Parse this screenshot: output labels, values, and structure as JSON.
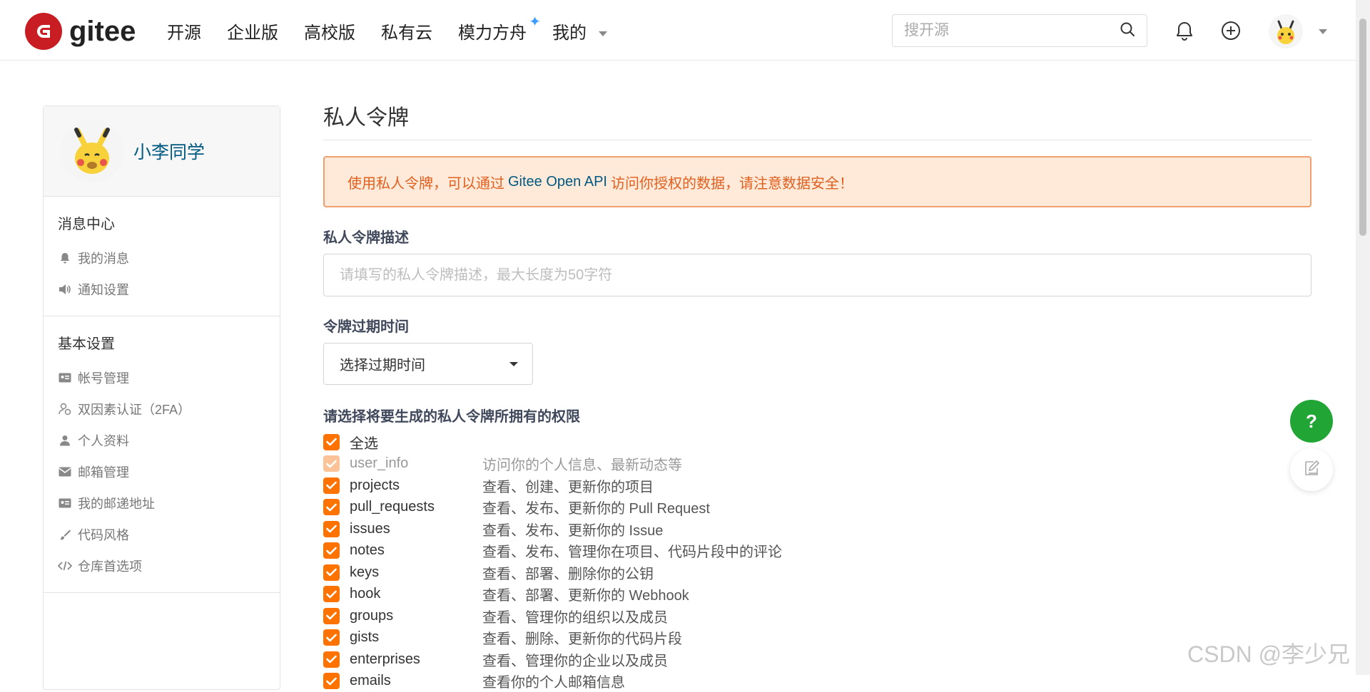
{
  "header": {
    "logo_text": "gitee",
    "nav": [
      "开源",
      "企业版",
      "高校版",
      "私有云",
      "模力方舟",
      "我的"
    ],
    "search_placeholder": "搜开源"
  },
  "sidebar": {
    "username": "小李同学",
    "sections": [
      {
        "title": "消息中心",
        "items": [
          {
            "label": "我的消息",
            "icon": "bell-icon"
          },
          {
            "label": "通知设置",
            "icon": "volume-icon"
          }
        ]
      },
      {
        "title": "基本设置",
        "items": [
          {
            "label": "帐号管理",
            "icon": "id-card-icon"
          },
          {
            "label": "双因素认证（2FA）",
            "icon": "user-shield-icon"
          },
          {
            "label": "个人资料",
            "icon": "user-icon"
          },
          {
            "label": "邮箱管理",
            "icon": "mail-icon"
          },
          {
            "label": "我的邮递地址",
            "icon": "address-card-icon"
          },
          {
            "label": "代码风格",
            "icon": "brush-icon"
          },
          {
            "label": "仓库首选项",
            "icon": "code-icon"
          }
        ]
      }
    ]
  },
  "main": {
    "title": "私人令牌",
    "notice_prefix": "使用私人令牌，可以通过",
    "notice_api": "Gitee Open API",
    "notice_suffix": "访问你授权的数据，请注意数据安全！",
    "desc_label": "私人令牌描述",
    "desc_placeholder": "请填写的私人令牌描述，最大长度为50字符",
    "expire_label": "令牌过期时间",
    "expire_select": "选择过期时间",
    "perm_title": "请选择将要生成的私人令牌所拥有的权限",
    "select_all": "全选",
    "permissions": [
      {
        "name": "user_info",
        "desc": "访问你的个人信息、最新动态等",
        "checked": true,
        "disabled": true
      },
      {
        "name": "projects",
        "desc": "查看、创建、更新你的项目",
        "checked": true,
        "disabled": false
      },
      {
        "name": "pull_requests",
        "desc": "查看、发布、更新你的 Pull Request",
        "checked": true,
        "disabled": false
      },
      {
        "name": "issues",
        "desc": "查看、发布、更新你的 Issue",
        "checked": true,
        "disabled": false
      },
      {
        "name": "notes",
        "desc": "查看、发布、管理你在项目、代码片段中的评论",
        "checked": true,
        "disabled": false
      },
      {
        "name": "keys",
        "desc": "查看、部署、删除你的公钥",
        "checked": true,
        "disabled": false
      },
      {
        "name": "hook",
        "desc": "查看、部署、更新你的 Webhook",
        "checked": true,
        "disabled": false
      },
      {
        "name": "groups",
        "desc": "查看、管理你的组织以及成员",
        "checked": true,
        "disabled": false
      },
      {
        "name": "gists",
        "desc": "查看、删除、更新你的代码片段",
        "checked": true,
        "disabled": false
      },
      {
        "name": "enterprises",
        "desc": "查看、管理你的企业以及成员",
        "checked": true,
        "disabled": false
      },
      {
        "name": "emails",
        "desc": "查看你的个人邮箱信息",
        "checked": true,
        "disabled": false
      }
    ]
  },
  "floating": {
    "help_label": "?"
  },
  "watermark": "CSDN @李少兄",
  "colors": {
    "brand": "#c71d23",
    "checkbox": "#fe7300",
    "help_button": "#21a535",
    "notice_bg": "#ffe9d9",
    "link": "#005980"
  }
}
